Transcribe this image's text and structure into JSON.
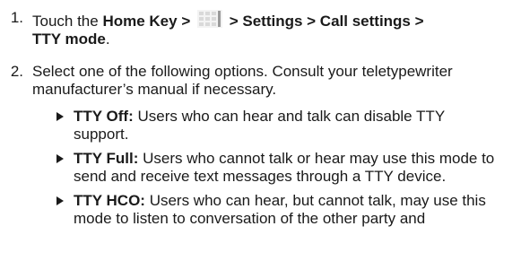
{
  "steps": [
    {
      "number": "1.",
      "touch": "Touch the ",
      "home_key": "Home Key >",
      "icon": "app-grid-icon",
      "path_bold_1": "> Settings > Call settings >",
      "path_bold_2": "TTY mode",
      "end": "."
    },
    {
      "number": "2.",
      "text": "Select one of the following options. Consult your teletypewriter manufacturer’s manual if necessary."
    }
  ],
  "options": [
    {
      "title": "TTY Off:",
      "text": " Users who can hear and talk can disable TTY support."
    },
    {
      "title": "TTY Full:",
      "text": " Users who cannot talk or hear may use this mode to send and receive text messages through a TTY device."
    },
    {
      "title": "TTY HCO:",
      "text": " Users who can hear, but cannot talk, may use this mode to listen to conversation of the other party and"
    }
  ],
  "colors": {
    "text": "#1a1a1a",
    "icon_light": "#d9d9d9",
    "icon_dark": "#9a9a9a"
  }
}
